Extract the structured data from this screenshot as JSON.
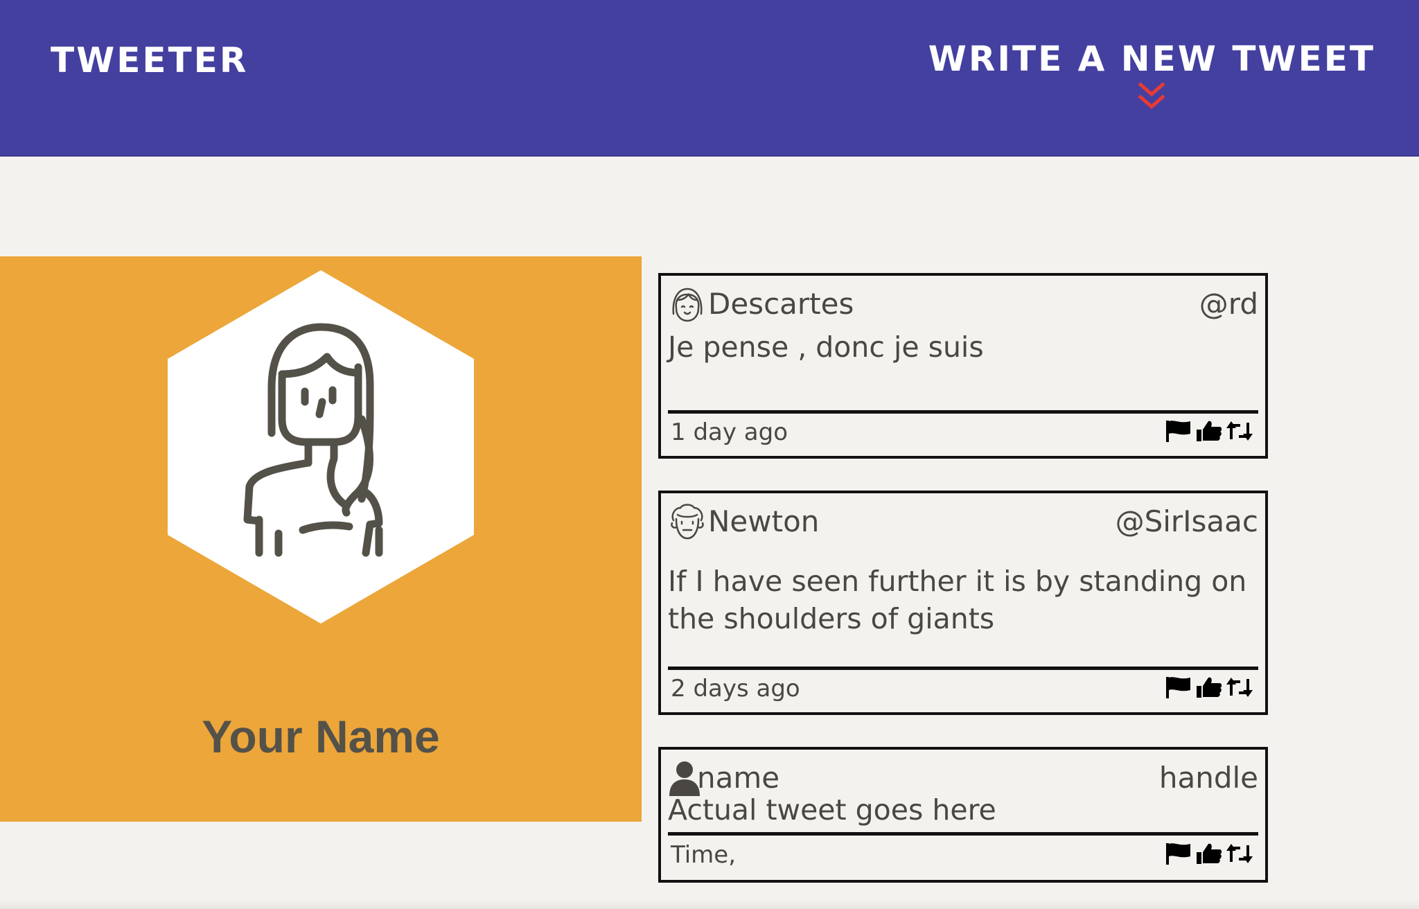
{
  "nav": {
    "brand": "TWEETER",
    "compose_label": "WRITE A NEW TWEET"
  },
  "profile": {
    "name": "Your Name"
  },
  "tweets": [
    {
      "author": "Descartes",
      "handle": "@rd",
      "text": "Je pense , donc je suis",
      "time": "1 day ago"
    },
    {
      "author": "Newton",
      "handle": "@SirIsaac",
      "text": "If I have seen further it is by standing on the shoulders of giants",
      "time": "2 days ago"
    },
    {
      "author": "name",
      "handle": "handle",
      "text": "Actual tweet goes here",
      "time": "Time,"
    }
  ],
  "colors": {
    "nav_bg": "#4440a0",
    "accent_chevron": "#e83a35",
    "profile_bg": "#eca63a",
    "page_bg": "#f4f2ee",
    "text_dark": "#4a4742"
  },
  "icons": {
    "compose": "double-chevron-down-icon",
    "tweet_actions": [
      "flag-icon",
      "thumbs-up-icon",
      "retweet-icon"
    ]
  }
}
